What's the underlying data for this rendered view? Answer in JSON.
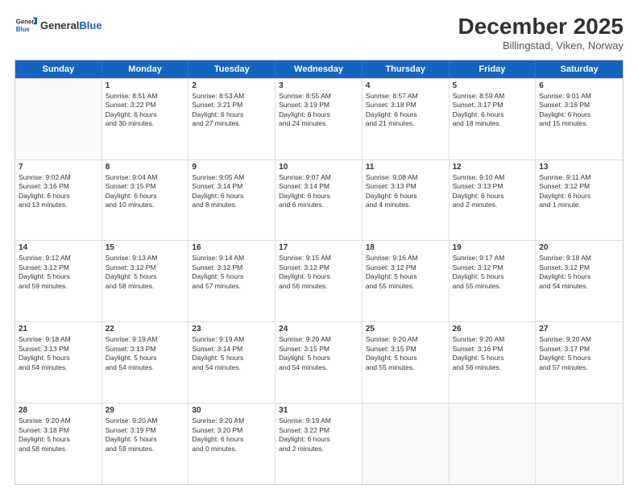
{
  "header": {
    "logo_general": "General",
    "logo_blue": "Blue",
    "title": "December 2025",
    "subtitle": "Billingstad, Viken, Norway"
  },
  "days": [
    "Sunday",
    "Monday",
    "Tuesday",
    "Wednesday",
    "Thursday",
    "Friday",
    "Saturday"
  ],
  "weeks": [
    [
      {
        "day": "",
        "sunrise": "",
        "sunset": "",
        "daylight": ""
      },
      {
        "day": "1",
        "sunrise": "Sunrise: 8:51 AM",
        "sunset": "Sunset: 3:22 PM",
        "daylight": "Daylight: 6 hours and 30 minutes."
      },
      {
        "day": "2",
        "sunrise": "Sunrise: 8:53 AM",
        "sunset": "Sunset: 3:21 PM",
        "daylight": "Daylight: 6 hours and 27 minutes."
      },
      {
        "day": "3",
        "sunrise": "Sunrise: 8:55 AM",
        "sunset": "Sunset: 3:19 PM",
        "daylight": "Daylight: 6 hours and 24 minutes."
      },
      {
        "day": "4",
        "sunrise": "Sunrise: 8:57 AM",
        "sunset": "Sunset: 3:18 PM",
        "daylight": "Daylight: 6 hours and 21 minutes."
      },
      {
        "day": "5",
        "sunrise": "Sunrise: 8:59 AM",
        "sunset": "Sunset: 3:17 PM",
        "daylight": "Daylight: 6 hours and 18 minutes."
      },
      {
        "day": "6",
        "sunrise": "Sunrise: 9:01 AM",
        "sunset": "Sunset: 3:16 PM",
        "daylight": "Daylight: 6 hours and 15 minutes."
      }
    ],
    [
      {
        "day": "7",
        "sunrise": "Sunrise: 9:02 AM",
        "sunset": "Sunset: 3:16 PM",
        "daylight": "Daylight: 6 hours and 13 minutes."
      },
      {
        "day": "8",
        "sunrise": "Sunrise: 9:04 AM",
        "sunset": "Sunset: 3:15 PM",
        "daylight": "Daylight: 6 hours and 10 minutes."
      },
      {
        "day": "9",
        "sunrise": "Sunrise: 9:05 AM",
        "sunset": "Sunset: 3:14 PM",
        "daylight": "Daylight: 6 hours and 8 minutes."
      },
      {
        "day": "10",
        "sunrise": "Sunrise: 9:07 AM",
        "sunset": "Sunset: 3:14 PM",
        "daylight": "Daylight: 6 hours and 6 minutes."
      },
      {
        "day": "11",
        "sunrise": "Sunrise: 9:08 AM",
        "sunset": "Sunset: 3:13 PM",
        "daylight": "Daylight: 6 hours and 4 minutes."
      },
      {
        "day": "12",
        "sunrise": "Sunrise: 9:10 AM",
        "sunset": "Sunset: 3:13 PM",
        "daylight": "Daylight: 6 hours and 2 minutes."
      },
      {
        "day": "13",
        "sunrise": "Sunrise: 9:11 AM",
        "sunset": "Sunset: 3:12 PM",
        "daylight": "Daylight: 6 hours and 1 minute."
      }
    ],
    [
      {
        "day": "14",
        "sunrise": "Sunrise: 9:12 AM",
        "sunset": "Sunset: 3:12 PM",
        "daylight": "Daylight: 5 hours and 59 minutes."
      },
      {
        "day": "15",
        "sunrise": "Sunrise: 9:13 AM",
        "sunset": "Sunset: 3:12 PM",
        "daylight": "Daylight: 5 hours and 58 minutes."
      },
      {
        "day": "16",
        "sunrise": "Sunrise: 9:14 AM",
        "sunset": "Sunset: 3:12 PM",
        "daylight": "Daylight: 5 hours and 57 minutes."
      },
      {
        "day": "17",
        "sunrise": "Sunrise: 9:15 AM",
        "sunset": "Sunset: 3:12 PM",
        "daylight": "Daylight: 5 hours and 56 minutes."
      },
      {
        "day": "18",
        "sunrise": "Sunrise: 9:16 AM",
        "sunset": "Sunset: 3:12 PM",
        "daylight": "Daylight: 5 hours and 55 minutes."
      },
      {
        "day": "19",
        "sunrise": "Sunrise: 9:17 AM",
        "sunset": "Sunset: 3:12 PM",
        "daylight": "Daylight: 5 hours and 55 minutes."
      },
      {
        "day": "20",
        "sunrise": "Sunrise: 9:18 AM",
        "sunset": "Sunset: 3:12 PM",
        "daylight": "Daylight: 5 hours and 54 minutes."
      }
    ],
    [
      {
        "day": "21",
        "sunrise": "Sunrise: 9:18 AM",
        "sunset": "Sunset: 3:13 PM",
        "daylight": "Daylight: 5 hours and 54 minutes."
      },
      {
        "day": "22",
        "sunrise": "Sunrise: 9:19 AM",
        "sunset": "Sunset: 3:13 PM",
        "daylight": "Daylight: 5 hours and 54 minutes."
      },
      {
        "day": "23",
        "sunrise": "Sunrise: 9:19 AM",
        "sunset": "Sunset: 3:14 PM",
        "daylight": "Daylight: 5 hours and 54 minutes."
      },
      {
        "day": "24",
        "sunrise": "Sunrise: 9:20 AM",
        "sunset": "Sunset: 3:15 PM",
        "daylight": "Daylight: 5 hours and 54 minutes."
      },
      {
        "day": "25",
        "sunrise": "Sunrise: 9:20 AM",
        "sunset": "Sunset: 3:15 PM",
        "daylight": "Daylight: 5 hours and 55 minutes."
      },
      {
        "day": "26",
        "sunrise": "Sunrise: 9:20 AM",
        "sunset": "Sunset: 3:16 PM",
        "daylight": "Daylight: 5 hours and 56 minutes."
      },
      {
        "day": "27",
        "sunrise": "Sunrise: 9:20 AM",
        "sunset": "Sunset: 3:17 PM",
        "daylight": "Daylight: 5 hours and 57 minutes."
      }
    ],
    [
      {
        "day": "28",
        "sunrise": "Sunrise: 9:20 AM",
        "sunset": "Sunset: 3:18 PM",
        "daylight": "Daylight: 5 hours and 58 minutes."
      },
      {
        "day": "29",
        "sunrise": "Sunrise: 9:20 AM",
        "sunset": "Sunset: 3:19 PM",
        "daylight": "Daylight: 5 hours and 59 minutes."
      },
      {
        "day": "30",
        "sunrise": "Sunrise: 9:20 AM",
        "sunset": "Sunset: 3:20 PM",
        "daylight": "Daylight: 6 hours and 0 minutes."
      },
      {
        "day": "31",
        "sunrise": "Sunrise: 9:19 AM",
        "sunset": "Sunset: 3:22 PM",
        "daylight": "Daylight: 6 hours and 2 minutes."
      },
      {
        "day": "",
        "sunrise": "",
        "sunset": "",
        "daylight": ""
      },
      {
        "day": "",
        "sunrise": "",
        "sunset": "",
        "daylight": ""
      },
      {
        "day": "",
        "sunrise": "",
        "sunset": "",
        "daylight": ""
      }
    ]
  ]
}
